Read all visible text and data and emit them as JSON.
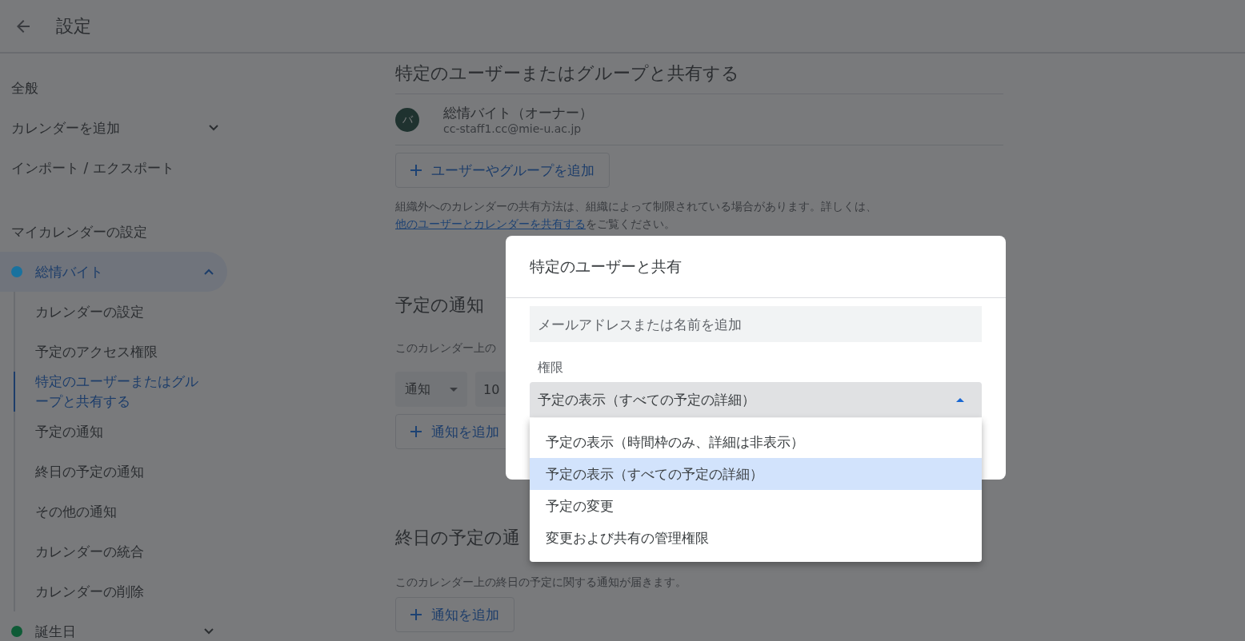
{
  "header": {
    "title": "設定"
  },
  "sidebar": {
    "items": [
      {
        "kind": "link",
        "label": "全般"
      },
      {
        "kind": "dropdown",
        "label": "カレンダーを追加",
        "expanded": false
      },
      {
        "kind": "link",
        "label": "インポート / エクスポート"
      }
    ],
    "section_title": "マイカレンダーの設定",
    "calendars": [
      {
        "name": "総情バイト",
        "color": "#19729f",
        "selected": true,
        "expanded": true,
        "children": [
          {
            "label": "カレンダーの設定",
            "selected": false
          },
          {
            "label": "予定のアクセス権限",
            "selected": false
          },
          {
            "label": "特定のユーザーまたはグループと共有する",
            "selected": true
          },
          {
            "label": "予定の通知",
            "selected": false
          },
          {
            "label": "終日の予定の通知",
            "selected": false
          },
          {
            "label": "その他の通知",
            "selected": false
          },
          {
            "label": "カレンダーの統合",
            "selected": false
          },
          {
            "label": "カレンダーの削除",
            "selected": false
          }
        ]
      },
      {
        "name": "誕生日",
        "color": "#0e5b36",
        "selected": false,
        "expanded": false
      }
    ]
  },
  "share_section": {
    "title": "特定のユーザーまたはグループと共有する",
    "members": [
      {
        "initial": "バ",
        "name": "総情バイト（オーナー）",
        "email": "cc-staff1.cc@mie-u.ac.jp"
      }
    ],
    "add_button": "ユーザーやグループを追加",
    "note": {
      "text": "組織外へのカレンダーの共有方法は、組織によって制限されている場合があります。詳しくは、",
      "link": "他のユーザーとカレンダーを共有する",
      "after": "をご覧ください。"
    }
  },
  "notification_section": {
    "title": "予定の通知",
    "description": "このカレンダー上の",
    "notification": {
      "type": "通知",
      "value": "10"
    },
    "add_button": "通知を追加"
  },
  "all_day_section": {
    "title": "終日の予定の通",
    "description": "このカレンダー上の終日の予定に関する通知が届きます。",
    "add_button": "通知を追加"
  },
  "dialog": {
    "title": "特定のユーザーと共有",
    "input": {
      "placeholder": "メールアドレスまたは名前を追加"
    },
    "permission": {
      "label": "権限",
      "value": "予定の表示（すべての予定の詳細）",
      "expanded": true,
      "options": [
        {
          "label": "予定の表示（時間枠のみ、詳細は非表示）",
          "selected": false
        },
        {
          "label": "予定の表示（すべての予定の詳細）",
          "selected": true
        },
        {
          "label": "予定の変更",
          "selected": false
        },
        {
          "label": "変更および共有の管理権限",
          "selected": false
        }
      ]
    }
  }
}
